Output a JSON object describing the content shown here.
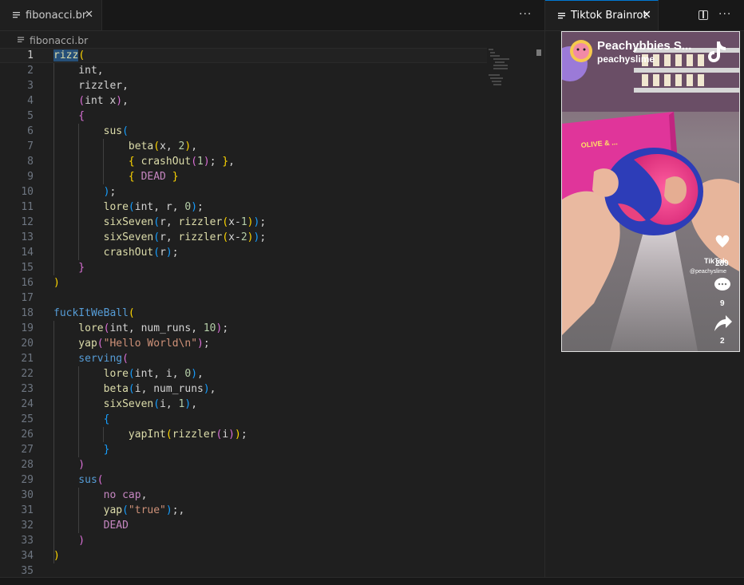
{
  "editor": {
    "tab": {
      "label": "fibonacci.br"
    },
    "breadcrumb": {
      "file": "fibonacci.br"
    },
    "active_line": 1,
    "selected_text": "rizz",
    "line_numbers": [
      "1",
      "2",
      "3",
      "4",
      "5",
      "6",
      "7",
      "8",
      "9",
      "10",
      "11",
      "12",
      "13",
      "14",
      "15",
      "16",
      "17",
      "18",
      "19",
      "20",
      "21",
      "22",
      "23",
      "24",
      "25",
      "26",
      "27",
      "28",
      "29",
      "30",
      "31",
      "32",
      "33",
      "34",
      "35"
    ],
    "lines": [
      [
        [
          "c-fn sel",
          "rizz"
        ],
        [
          "c-p1",
          "("
        ]
      ],
      [
        [
          "c-var",
          "    int,"
        ]
      ],
      [
        [
          "c-var",
          "    rizzler,"
        ]
      ],
      [
        [
          "c-p2",
          "    ("
        ],
        [
          "c-var",
          "int x"
        ],
        [
          "c-p2",
          ")"
        ],
        [
          "c-var",
          ","
        ]
      ],
      [
        [
          "c-p2",
          "    {"
        ]
      ],
      [
        [
          "c-fn",
          "        sus"
        ],
        [
          "c-p3",
          "("
        ]
      ],
      [
        [
          "c-fn",
          "            beta"
        ],
        [
          "c-p1",
          "("
        ],
        [
          "c-var",
          "x, "
        ],
        [
          "c-num",
          "2"
        ],
        [
          "c-p1",
          ")"
        ],
        [
          "c-var",
          ","
        ]
      ],
      [
        [
          "c-p1",
          "            { "
        ],
        [
          "c-fn",
          "crashOut"
        ],
        [
          "c-p2",
          "("
        ],
        [
          "c-num",
          "1"
        ],
        [
          "c-p2",
          ")"
        ],
        [
          "c-var",
          "; "
        ],
        [
          "c-p1",
          "}"
        ],
        [
          "c-var",
          ","
        ]
      ],
      [
        [
          "c-p1",
          "            { "
        ],
        [
          "c-purple",
          "DEAD"
        ],
        [
          "c-p1",
          " }"
        ]
      ],
      [
        [
          "c-p3",
          "        )"
        ],
        [
          "c-var",
          ";"
        ]
      ],
      [
        [
          "c-fn",
          "        lore"
        ],
        [
          "c-p3",
          "("
        ],
        [
          "c-var",
          "int, r, "
        ],
        [
          "c-num",
          "0"
        ],
        [
          "c-p3",
          ")"
        ],
        [
          "c-var",
          ";"
        ]
      ],
      [
        [
          "c-fn",
          "        sixSeven"
        ],
        [
          "c-p3",
          "("
        ],
        [
          "c-var",
          "r, "
        ],
        [
          "c-fn",
          "rizzler"
        ],
        [
          "c-p1",
          "("
        ],
        [
          "c-var",
          "x-"
        ],
        [
          "c-num",
          "1"
        ],
        [
          "c-p1",
          ")"
        ],
        [
          "c-p3",
          ")"
        ],
        [
          "c-var",
          ";"
        ]
      ],
      [
        [
          "c-fn",
          "        sixSeven"
        ],
        [
          "c-p3",
          "("
        ],
        [
          "c-var",
          "r, "
        ],
        [
          "c-fn",
          "rizzler"
        ],
        [
          "c-p1",
          "("
        ],
        [
          "c-var",
          "x-"
        ],
        [
          "c-num",
          "2"
        ],
        [
          "c-p1",
          ")"
        ],
        [
          "c-p3",
          ")"
        ],
        [
          "c-var",
          ";"
        ]
      ],
      [
        [
          "c-fn",
          "        crashOut"
        ],
        [
          "c-p3",
          "("
        ],
        [
          "c-var",
          "r"
        ],
        [
          "c-p3",
          ")"
        ],
        [
          "c-var",
          ";"
        ]
      ],
      [
        [
          "c-p2",
          "    }"
        ]
      ],
      [
        [
          "c-p1",
          ")"
        ]
      ],
      [
        [
          "c-var",
          ""
        ]
      ],
      [
        [
          "c-kw",
          "fuckItWeBall"
        ],
        [
          "c-p1",
          "("
        ]
      ],
      [
        [
          "c-fn",
          "    lore"
        ],
        [
          "c-p2",
          "("
        ],
        [
          "c-var",
          "int, num_runs, "
        ],
        [
          "c-num",
          "10"
        ],
        [
          "c-p2",
          ")"
        ],
        [
          "c-var",
          ";"
        ]
      ],
      [
        [
          "c-fn",
          "    yap"
        ],
        [
          "c-p2",
          "("
        ],
        [
          "c-str",
          "\"Hello World\\n\""
        ],
        [
          "c-p2",
          ")"
        ],
        [
          "c-var",
          ";"
        ]
      ],
      [
        [
          "c-kw",
          "    serving"
        ],
        [
          "c-p2",
          "("
        ]
      ],
      [
        [
          "c-fn",
          "        lore"
        ],
        [
          "c-p3",
          "("
        ],
        [
          "c-var",
          "int, i, "
        ],
        [
          "c-num",
          "0"
        ],
        [
          "c-p3",
          ")"
        ],
        [
          "c-var",
          ","
        ]
      ],
      [
        [
          "c-fn",
          "        beta"
        ],
        [
          "c-p3",
          "("
        ],
        [
          "c-var",
          "i, num_runs"
        ],
        [
          "c-p3",
          ")"
        ],
        [
          "c-var",
          ","
        ]
      ],
      [
        [
          "c-fn",
          "        sixSeven"
        ],
        [
          "c-p3",
          "("
        ],
        [
          "c-var",
          "i, "
        ],
        [
          "c-num",
          "1"
        ],
        [
          "c-p3",
          ")"
        ],
        [
          "c-var",
          ","
        ]
      ],
      [
        [
          "c-p3",
          "        {"
        ]
      ],
      [
        [
          "c-fn",
          "            yapInt"
        ],
        [
          "c-p1",
          "("
        ],
        [
          "c-fn",
          "rizzler"
        ],
        [
          "c-p2",
          "("
        ],
        [
          "c-var",
          "i"
        ],
        [
          "c-p2",
          ")"
        ],
        [
          "c-p1",
          ")"
        ],
        [
          "c-var",
          ";"
        ]
      ],
      [
        [
          "c-p3",
          "        }"
        ]
      ],
      [
        [
          "c-p2",
          "    )"
        ]
      ],
      [
        [
          "c-kw",
          "    sus"
        ],
        [
          "c-p2",
          "("
        ]
      ],
      [
        [
          "c-purple",
          "        no cap"
        ],
        [
          "c-var",
          ","
        ]
      ],
      [
        [
          "c-fn",
          "        yap"
        ],
        [
          "c-p3",
          "("
        ],
        [
          "c-str",
          "\"true\""
        ],
        [
          "c-p3",
          ")"
        ],
        [
          "c-var",
          ";,"
        ]
      ],
      [
        [
          "c-purple",
          "        DEAD"
        ]
      ],
      [
        [
          "c-p2",
          "    )"
        ]
      ],
      [
        [
          "c-p1",
          ")"
        ]
      ],
      [
        [
          "c-var",
          ""
        ]
      ]
    ]
  },
  "preview": {
    "tab": {
      "label": "Tiktok Brainrot"
    },
    "video": {
      "account_name": "Peachybbies S...",
      "handle": "peachyslime",
      "likes": "289",
      "comments": "9",
      "shares": "2",
      "watermark": "TikTok",
      "watermark_handle": "@peachyslime",
      "box_text": "OLIVE & ..."
    }
  },
  "icons": {
    "file": "lines-icon",
    "close": "close-icon",
    "more": "ellipsis-icon",
    "split": "split-editor-icon"
  }
}
